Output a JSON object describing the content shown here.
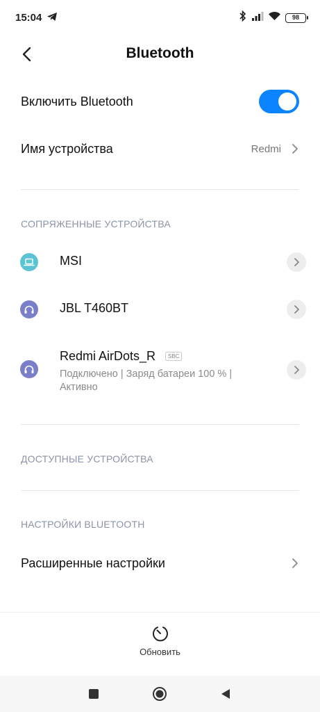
{
  "status_bar": {
    "time": "15:04",
    "left_icon": "telegram-icon",
    "right_icons": [
      "bluetooth-icon",
      "signal-icon",
      "wifi-icon"
    ],
    "battery": "98"
  },
  "header": {
    "title": "Bluetooth",
    "back_icon": "back-arrow-icon"
  },
  "settings": {
    "enable_label": "Включить Bluetooth",
    "enable_on": true,
    "device_name_label": "Имя устройства",
    "device_name_value": "Redmi"
  },
  "paired": {
    "header": "СОПРЯЖЕННЫЕ УСТРОЙСТВА",
    "devices": [
      {
        "name": "MSI",
        "icon": "laptop-icon"
      },
      {
        "name": "JBL T460BT",
        "icon": "headphones-icon"
      },
      {
        "name": "Redmi AirDots_R",
        "icon": "headphones-icon",
        "codec": "SBC",
        "status_line1": "Подключено | Заряд батареи 100 % |",
        "status_line2": "Активно"
      }
    ]
  },
  "available": {
    "header": "ДОСТУПНЫЕ УСТРОЙСТВА"
  },
  "bt_settings": {
    "header": "НАСТРОЙКИ BLUETOOTH",
    "advanced_label": "Расширенные настройки"
  },
  "refresh": {
    "label": "Обновить",
    "icon": "refresh-icon"
  },
  "colors": {
    "accent": "#0d84ff",
    "laptop_icon_bg": "#5bc4d4",
    "headphones_icon_bg": "#7b7fc9",
    "section_header": "#8a93a8"
  }
}
